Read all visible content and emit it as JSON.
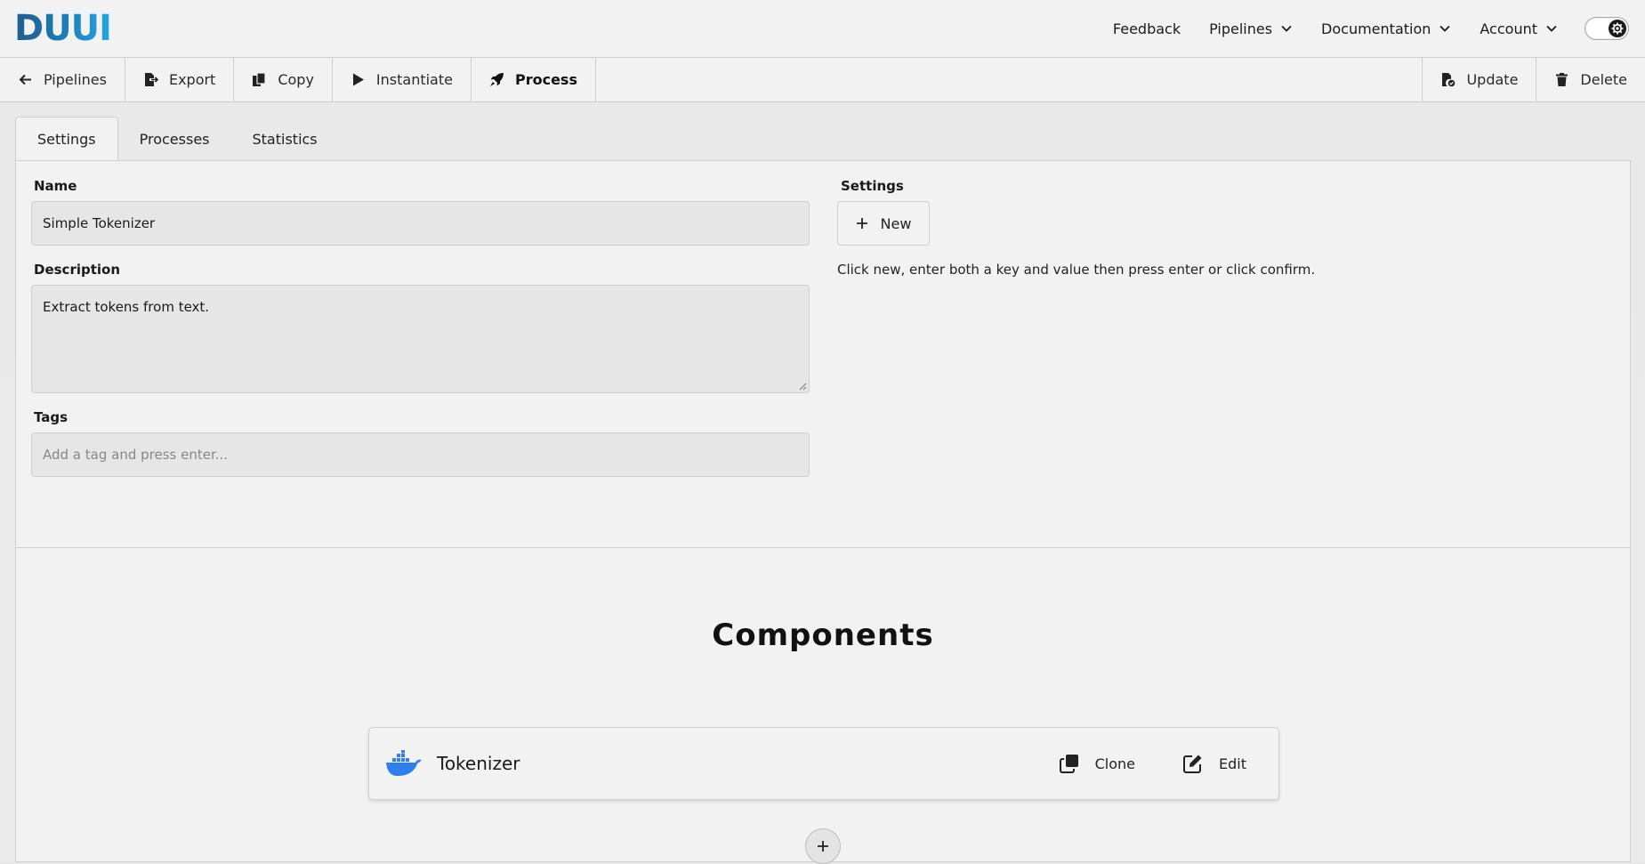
{
  "logo": {
    "text": "DUUI"
  },
  "nav": {
    "feedback": "Feedback",
    "pipelines": "Pipelines",
    "documentation": "Documentation",
    "account": "Account"
  },
  "toolbar": {
    "back": "Pipelines",
    "export": "Export",
    "copy": "Copy",
    "instantiate": "Instantiate",
    "process": "Process",
    "update": "Update",
    "delete": "Delete"
  },
  "tabs": [
    "Settings",
    "Processes",
    "Statistics"
  ],
  "form": {
    "name_label": "Name",
    "name_value": "Simple Tokenizer",
    "description_label": "Description",
    "description_value": "Extract tokens from text.",
    "tags_label": "Tags",
    "tags_placeholder": "Add a tag and press enter..."
  },
  "settings": {
    "label": "Settings",
    "new_button": "New",
    "hint": "Click new, enter both a key and value then press enter or click confirm."
  },
  "components": {
    "title": "Components",
    "items": [
      {
        "name": "Tokenizer",
        "icon": "docker-icon",
        "clone": "Clone",
        "edit": "Edit"
      }
    ]
  },
  "colors": {
    "logo_dark": "#1f5d8c",
    "logo_light": "#25a7e0",
    "docker_blue": "#2f80ed",
    "background": "#f2f2f2"
  }
}
